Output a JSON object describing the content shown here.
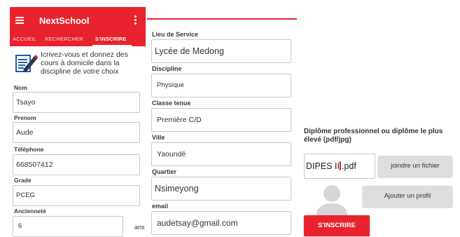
{
  "appbar": {
    "title": "NextSchool",
    "menu_icon": "hamburger-icon",
    "more_icon": "more-vert-icon"
  },
  "tabs": [
    {
      "label": "ACCUEIL",
      "active": false
    },
    {
      "label": "RECHERCHER",
      "active": false
    },
    {
      "label": "S'INSCRIRE",
      "active": true
    }
  ],
  "intro": {
    "icon": "form-pencil-icon",
    "text": "Icrivez-vous et donnez des cours à domicile dans la discipline de votre choix"
  },
  "form_left": {
    "nom": {
      "label": "Nom",
      "value": "Tsayo"
    },
    "prenom": {
      "label": "Prenom",
      "value": "Aude"
    },
    "telephone": {
      "label": "Téléphone",
      "value": "668507412"
    },
    "grade": {
      "label": "Grade",
      "value": "PCEG"
    },
    "anciennete": {
      "label": "Ancienneté",
      "value": "6",
      "suffix": "ans"
    }
  },
  "form_right": {
    "lieu": {
      "label": "Lieu de Service",
      "value": "Lycée de Medong"
    },
    "discipline": {
      "label": "Discipline",
      "value": "Physique"
    },
    "classe": {
      "label": "Classe tenue",
      "value": "Première C/D"
    },
    "ville": {
      "label": "Ville",
      "value": "Yaoundé"
    },
    "quartier": {
      "label": "Quartier",
      "value": "Nsimeyong"
    },
    "email": {
      "label": "email",
      "value": "audetsay@gmail.com"
    }
  },
  "diploma": {
    "title": "Diplôme professionnel ou diplôme le plus élevé (pdf/jpg)",
    "file_before": "DIPES II",
    "file_after": ".pdf",
    "attach_button": "joindre un fichier",
    "profile_button": "Ajouter un profil",
    "submit_button": "S'INSCRIRE",
    "avatar_icon": "avatar-placeholder-icon"
  },
  "colors": {
    "primary": "#e8232e",
    "button_gray": "#dedede"
  }
}
